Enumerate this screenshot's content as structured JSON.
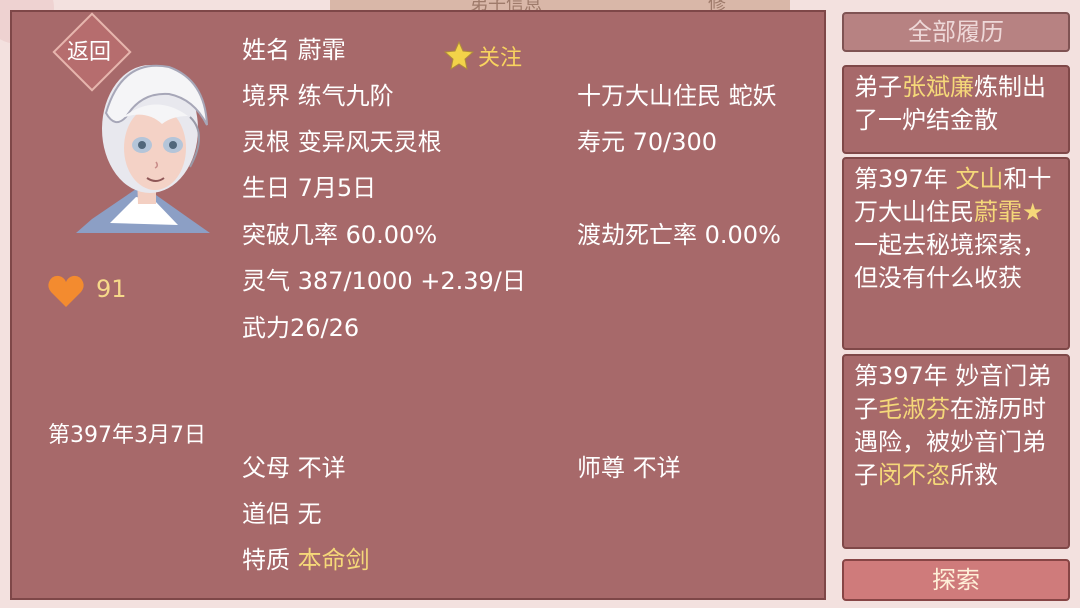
{
  "character": {
    "back_label": "返回",
    "follow_label": "关注",
    "favor": "91",
    "current_date": "第397年3月7日",
    "rows": [
      {
        "label": "姓名",
        "value": "蔚霏"
      },
      {
        "label": "境界",
        "value": "练气九阶"
      },
      {
        "label": "灵根",
        "value": "变异风天灵根"
      },
      {
        "label": "生日",
        "value": "7月5日"
      },
      {
        "label": "突破几率",
        "value": "60.00%"
      },
      {
        "label": "灵气",
        "value": "387/1000 +2.39/日"
      },
      {
        "label": "武力",
        "value": "26/26"
      }
    ],
    "right_rows": [
      {
        "label": "十万大山住民",
        "value": "蛇妖"
      },
      {
        "label": "寿元",
        "value": "70/300"
      },
      {
        "label": "渡劫死亡率",
        "value": "0.00%"
      }
    ],
    "relations": [
      {
        "label": "父母",
        "value": "不详"
      },
      {
        "label": "道侣",
        "value": "无"
      },
      {
        "label": "特质",
        "value": "本命剑"
      }
    ],
    "master": {
      "label": "师尊",
      "value": "不详"
    }
  },
  "history": {
    "all_label": "全部履历",
    "records": [
      {
        "text": "弟子张斌廉炼制出了一炉结金散",
        "prefix": "弟子",
        "name": "张斌廉",
        "suffix": "炼制出了一炉结金散"
      },
      {
        "text": "第397年 文山和十万大山住民蔚霏★一起去秘境探索，但没有什么收获",
        "prefix": "第397年 ",
        "name": "文山",
        "middle": "和十万大山住民",
        "name2": "蔚霏★",
        "suffix": "一起去秘境探索，但没有什么收获"
      },
      {
        "text": "第397年 妙音门弟子毛淑芬在游历时遇险，被妙音门弟子闵不恣所救",
        "prefix": "第397年 妙音门弟子",
        "name": "毛淑芬",
        "middle": "在游历时遇险，被妙音门弟子",
        "name2": "闵不恣",
        "suffix": "所救"
      }
    ],
    "explore_label": "探索"
  },
  "top_tabs": [
    "弟子信息",
    "修"
  ]
}
